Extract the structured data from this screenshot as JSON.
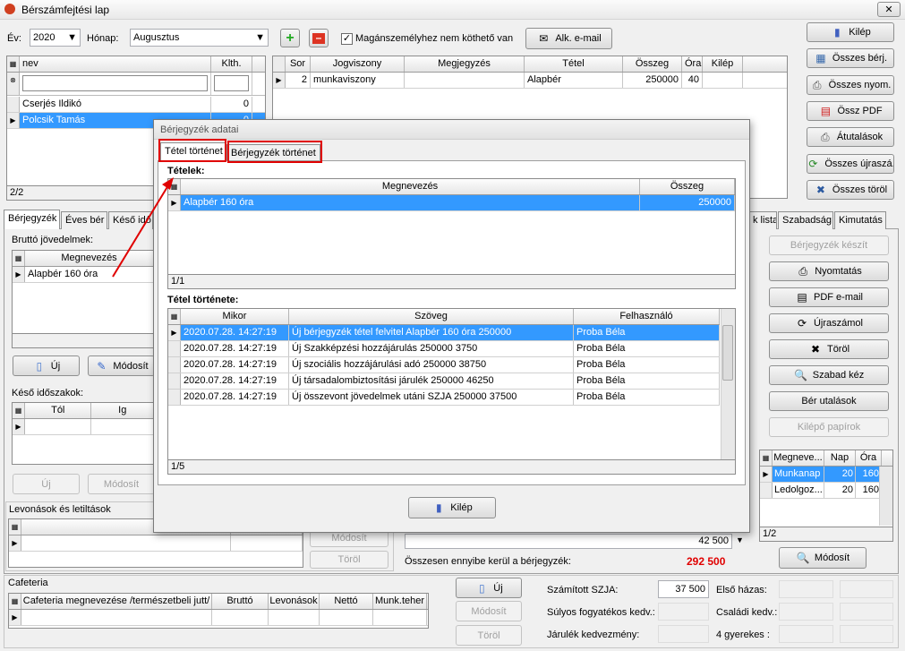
{
  "window": {
    "title": "Bérszámfejtési lap",
    "close": "✕"
  },
  "top": {
    "year_label": "Év:",
    "year": "2020",
    "month_label": "Hónap:",
    "month": "Augusztus",
    "checkbox_label": "Magánszemélyhez nem köthető van",
    "alk_email": "Alk. e-mail"
  },
  "right_buttons": [
    "Kilép",
    "Összes bérj.",
    "Összes nyom.",
    "Össz PDF",
    "Átutalások",
    "Összes újraszá.",
    "Összes töröl"
  ],
  "employees": {
    "col_name": "nev",
    "col_klth": "Klth.",
    "rows": [
      {
        "name": "Cserjés Ildikó",
        "klth": "0"
      },
      {
        "name": "Polcsik Tamás",
        "klth": "0"
      }
    ],
    "footer": "2/2"
  },
  "jogv": {
    "headers": [
      "Sor",
      "Jogviszony",
      "Megjegyzés",
      "Tétel",
      "Összeg",
      "Óra",
      "Kilép"
    ],
    "row": [
      "2",
      "munkaviszony",
      "",
      "Alapbér",
      "250000",
      "40",
      ""
    ]
  },
  "tabs": [
    "Bérjegyzék",
    "Éves bér",
    "Késő idő",
    "k lista",
    "Szabadság",
    "Kimutatás"
  ],
  "brutto": {
    "title": "Bruttó jövedelmek:",
    "col": "Megnevezés",
    "row": "Alapbér 160 óra",
    "new": "Új",
    "edit": "Módosít"
  },
  "keso": {
    "title": "Késő időszakok:",
    "col_from": "Tól",
    "col_to": "Ig",
    "new": "Új",
    "edit": "Módosít"
  },
  "levon": {
    "title": "Levonások és letiltások",
    "col": "Megnevezés",
    "edit": "Módosít",
    "delete": "Töröl"
  },
  "bottom_mid": {
    "amount": "42 500",
    "total_label": "Összesen ennyibe kerül a bérjegyzék:",
    "total": "292 500"
  },
  "right_panel": {
    "buttons": [
      "Bérjegyzék készít",
      "Nyomtatás",
      "PDF e-mail",
      "Újraszámol",
      "Töröl",
      "Szabad kéz",
      "Bér utalások",
      "Kilépő papírok"
    ]
  },
  "ora": {
    "headers": [
      "Megneve...",
      "Nap",
      "Óra"
    ],
    "rows": [
      [
        "Munkanap",
        "20",
        "160"
      ],
      [
        "Ledolgoz...",
        "20",
        "160"
      ]
    ],
    "footer": "1/2",
    "edit": "Módosít"
  },
  "cafeteria": {
    "title": "Cafeteria",
    "headers": [
      "Cafeteria megnevezése /természetbeli jutt/",
      "Bruttó",
      "Levonások",
      "Nettó",
      "Munk.teher"
    ],
    "new": "Új",
    "edit": "Módosít",
    "delete": "Töröl"
  },
  "tax": {
    "szja_label": "Számított SZJA:",
    "szja": "37 500",
    "elso_hazas": "Első házas:",
    "sulyos": "Súlyos fogyatékos kedv.:",
    "csaladi": "Családi kedv.:",
    "jarulek": "Járulék kedvezmény:",
    "gyerekes": "4 gyerekes :"
  },
  "dialog": {
    "title": "Bérjegyzék adatai",
    "tab1": "Tétel történet",
    "tab2": "Bérjegyzék történet",
    "tetelek_title": "Tételek:",
    "tetelek_headers": [
      "Megnevezés",
      "Összeg"
    ],
    "tetelek_row": [
      "Alapbér 160 óra",
      "250000"
    ],
    "tetelek_footer": "1/1",
    "tortenet_title": "Tétel története:",
    "tortenet_headers": [
      "Mikor",
      "Szöveg",
      "Felhasználó"
    ],
    "tortenet_rows": [
      [
        "2020.07.28. 14:27:19",
        "Új bérjegyzék tétel felvitel Alapbér 160 óra 250000",
        "Proba Béla"
      ],
      [
        "2020.07.28. 14:27:19",
        "Új Szakképzési hozzájárulás 250000 3750",
        "Proba Béla"
      ],
      [
        "2020.07.28. 14:27:19",
        "Új szociális hozzájárulási adó 250000 38750",
        "Proba Béla"
      ],
      [
        "2020.07.28. 14:27:19",
        "Új társadalombiztosítási járulék 250000 46250",
        "Proba Béla"
      ],
      [
        "2020.07.28. 14:27:19",
        "Új összevont jövedelmek utáni SZJA 250000 37500",
        "Proba Béla"
      ]
    ],
    "tortenet_footer": "1/5",
    "exit": "Kilép"
  },
  "colors": {
    "selection": "#3399ff",
    "annotation": "#e00000",
    "total": "#e00000"
  }
}
